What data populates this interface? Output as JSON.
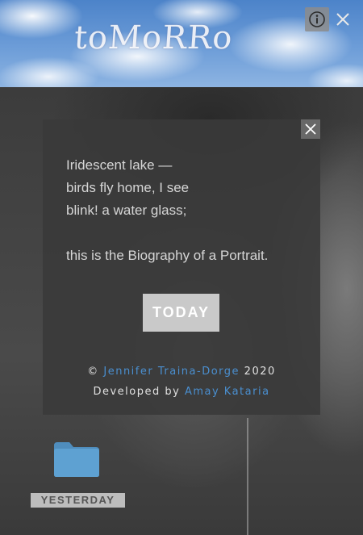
{
  "header": {
    "logo_text": "toMoRRo",
    "icons": [
      "info-icon",
      "close-icon"
    ]
  },
  "modal": {
    "poem_lines": [
      "Iridescent lake —",
      "birds fly home, I see",
      "blink! a water glass;"
    ],
    "tagline": "this is the Biography of a Portrait.",
    "today_label": "TODAY",
    "credits": {
      "copyright_symbol": "©",
      "author": "Jennifer Traina-Dorge",
      "year": "2020",
      "developed_by": "Developed by",
      "developer": "Amay Kataria"
    },
    "close_icon": "close-icon"
  },
  "desktop": {
    "folder_label": "YESTERDAY",
    "folder_icon": "folder-icon"
  },
  "colors": {
    "link": "#4a8fd0",
    "folder": "#5a9bcb",
    "modal_bg": "#3a3a3a",
    "button_bg": "#c9c9c9"
  }
}
